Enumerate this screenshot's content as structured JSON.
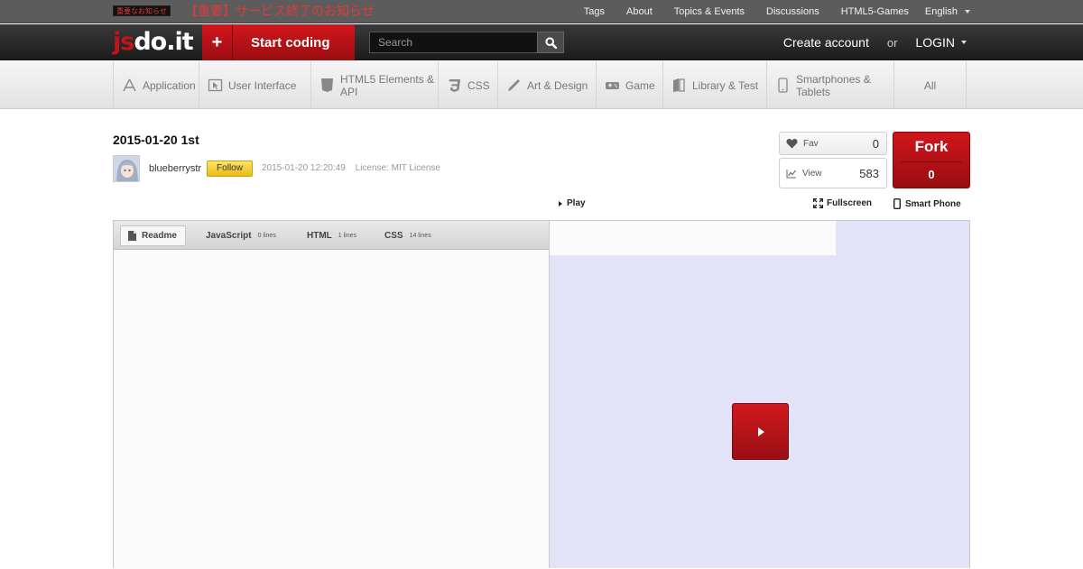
{
  "topbar": {
    "notice_badge": "重要なお知らせ",
    "notice_text": "【重要】サービス終了のお知らせ",
    "links": [
      "Tags",
      "About",
      "Topics & Events",
      "Discussions",
      "HTML5-Games"
    ],
    "language": "English"
  },
  "header": {
    "logo_js": "js",
    "logo_rest": "do.it",
    "start_coding_icon": "+",
    "start_coding": "Start coding",
    "search_placeholder": "Search",
    "create_account": "Create account",
    "or": "or",
    "login": "LOGIN"
  },
  "categories": [
    {
      "label": "Application",
      "icon": "application-icon"
    },
    {
      "label": "User Interface",
      "icon": "cursor-icon"
    },
    {
      "label": "HTML5 Elements & API",
      "icon": "html5-shield-icon"
    },
    {
      "label": "CSS",
      "icon": "css3-icon"
    },
    {
      "label": "Art & Design",
      "icon": "pen-icon"
    },
    {
      "label": "Game",
      "icon": "gamepad-icon"
    },
    {
      "label": "Library & Test",
      "icon": "books-icon"
    },
    {
      "label": "Smartphones & Tablets",
      "icon": "smartphone-icon"
    },
    {
      "label": "All",
      "icon": ""
    }
  ],
  "code": {
    "title": "2015-01-20 1st",
    "author": "blueberrystr",
    "follow": "Follow",
    "date": "2015-01-20 12:20:49",
    "license": "License: MIT License"
  },
  "stats": {
    "fav_label": "Fav",
    "fav": "0",
    "view_label": "View",
    "view": "583",
    "fork_label": "Fork",
    "fork": "0"
  },
  "actions": {
    "play": "Play",
    "fullscreen": "Fullscreen",
    "smartphone": "Smart Phone"
  },
  "editor_tabs": [
    {
      "label": "Readme",
      "lines": ""
    },
    {
      "label": "JavaScript",
      "lines": "0 lines"
    },
    {
      "label": "HTML",
      "lines": "1 lines"
    },
    {
      "label": "CSS",
      "lines": "14 lines"
    }
  ],
  "colors": {
    "brand_red": "#c0141a",
    "preview_bg": "#e2e2f8",
    "follow_yellow": "#f2cb2a"
  }
}
